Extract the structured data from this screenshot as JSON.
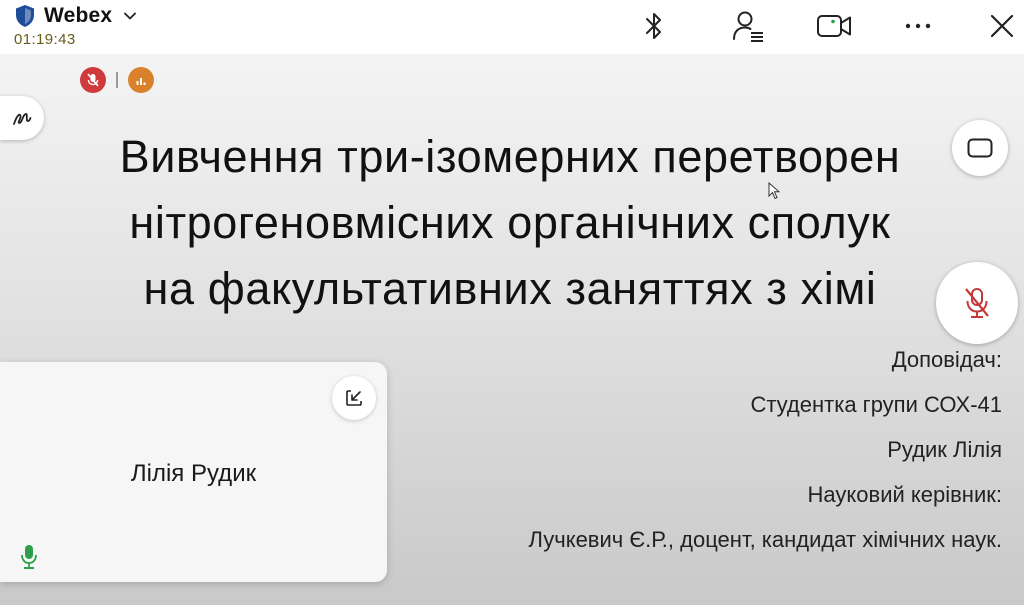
{
  "app": {
    "name": "Webex",
    "timer": "01:19:43"
  },
  "toolbar": {
    "icons": [
      "bluetooth-icon",
      "participants-icon",
      "video-camera-icon",
      "more-icon",
      "close-icon"
    ]
  },
  "slide": {
    "title_lines": [
      "Вивчення три-ізомерних перетворен",
      "нітрогеновмісних органічних сполук",
      "на факультативних заняттях з хімі"
    ],
    "author_lines": [
      "Доповідач:",
      "Студентка групи СОХ-41",
      "Рудик Лілія",
      "Науковий керівник:",
      "Лучкевич Є.Р., доцент, кандидат хімічних наук."
    ]
  },
  "self_view": {
    "name": "Лілія Рудик"
  },
  "colors": {
    "mute_red": "#d13a3a",
    "audio_orange": "#d9822b",
    "mic_green": "#2e9e4a",
    "brand_blue": "#1f4d9a",
    "timer": "#6b5b1a"
  }
}
